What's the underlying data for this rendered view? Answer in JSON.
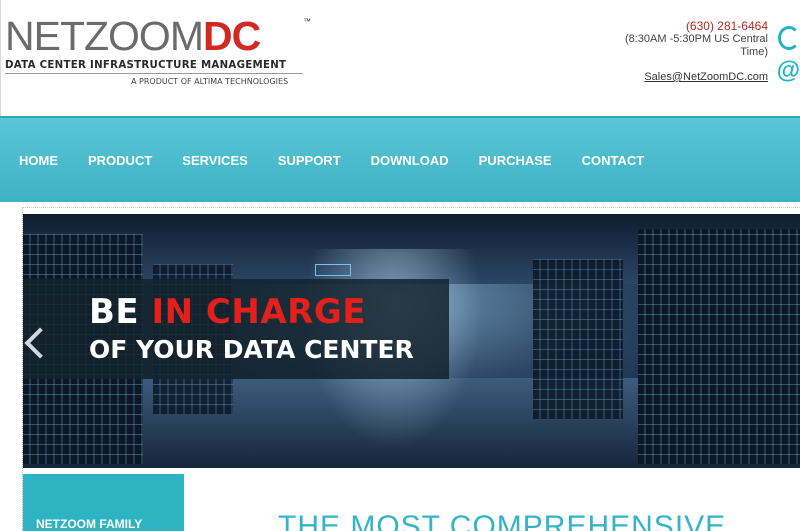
{
  "header": {
    "logo_net": "NETZOOM",
    "logo_dc": "DC",
    "logo_tm": "™",
    "logo_subtitle": "DATA CENTER INFRASTRUCTURE MANAGEMENT",
    "logo_product": "A PRODUCT OF ALTIMA TECHNOLOGIES",
    "phone": "(630) 281-6464",
    "hours": "(8:30AM -5:30PM US Central Time)",
    "email": "Sales@NetZoomDC.com",
    "icons": [
      "phone-icon",
      "at-icon"
    ]
  },
  "nav": {
    "items": [
      {
        "label": "HOME"
      },
      {
        "label": "PRODUCT"
      },
      {
        "label": "SERVICES"
      },
      {
        "label": "SUPPORT"
      },
      {
        "label": "DOWNLOAD"
      },
      {
        "label": "PURCHASE"
      },
      {
        "label": "CONTACT"
      }
    ]
  },
  "slider": {
    "line1_prefix": "BE ",
    "line1_highlight": "IN CHARGE",
    "line2": "OF YOUR DATA CENTER",
    "highlight_color": "#e3201b"
  },
  "sidebar": {
    "family_label": "NETZOOM FAMILY"
  },
  "main": {
    "headline": "THE MOST COMPREHENSIVE"
  },
  "colors": {
    "accent": "#3fb2c4",
    "brand_red": "#d12a22"
  }
}
